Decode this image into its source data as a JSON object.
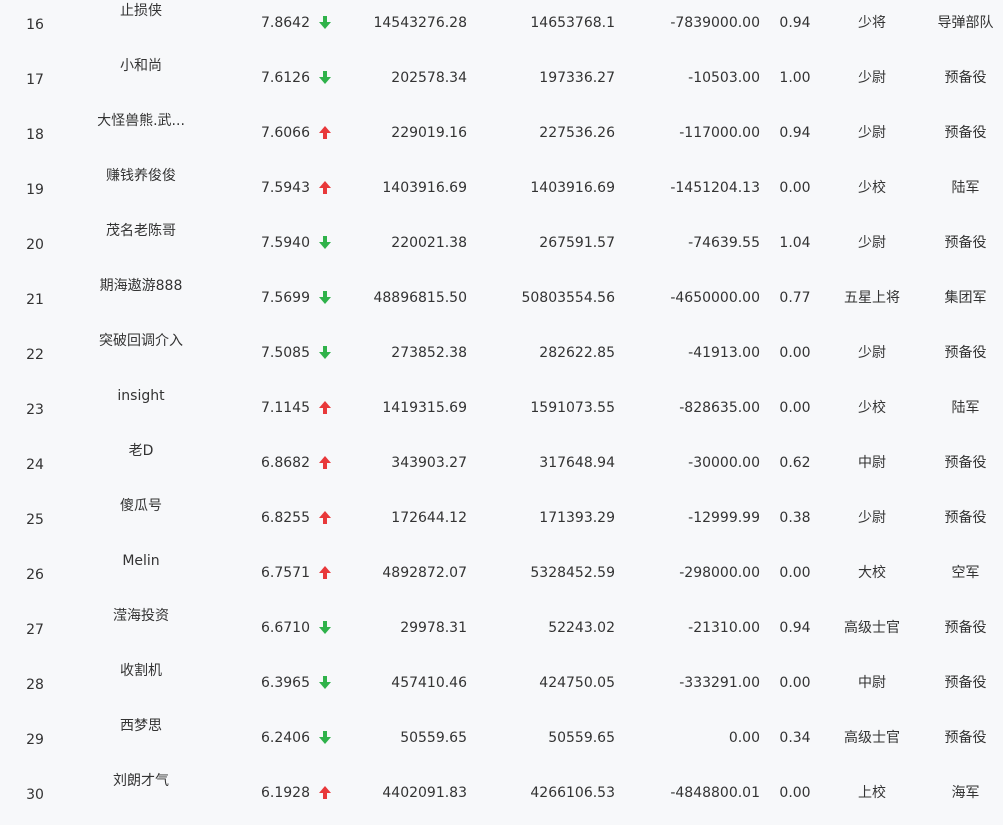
{
  "colors": {
    "background": "#f7f8fa",
    "text": "#333333",
    "arrow_up": "#e8383a",
    "arrow_down": "#2fb24a"
  },
  "rows": [
    {
      "rank": "16",
      "name": "止损侠",
      "score": "7.8642",
      "trend": "down",
      "v1": "14543276.28",
      "v2": "14653768.1",
      "v3": "-7839000.00",
      "v4": "0.94",
      "military_rank": "少将",
      "unit": "导弹部队"
    },
    {
      "rank": "17",
      "name": "小和尚",
      "score": "7.6126",
      "trend": "down",
      "v1": "202578.34",
      "v2": "197336.27",
      "v3": "-10503.00",
      "v4": "1.00",
      "military_rank": "少尉",
      "unit": "预备役"
    },
    {
      "rank": "18",
      "name": "大怪兽熊.武...",
      "score": "7.6066",
      "trend": "up",
      "v1": "229019.16",
      "v2": "227536.26",
      "v3": "-117000.00",
      "v4": "0.94",
      "military_rank": "少尉",
      "unit": "预备役"
    },
    {
      "rank": "19",
      "name": "赚钱养俊俊",
      "score": "7.5943",
      "trend": "up",
      "v1": "1403916.69",
      "v2": "1403916.69",
      "v3": "-1451204.13",
      "v4": "0.00",
      "military_rank": "少校",
      "unit": "陆军"
    },
    {
      "rank": "20",
      "name": "茂名老陈哥",
      "score": "7.5940",
      "trend": "down",
      "v1": "220021.38",
      "v2": "267591.57",
      "v3": "-74639.55",
      "v4": "1.04",
      "military_rank": "少尉",
      "unit": "预备役"
    },
    {
      "rank": "21",
      "name": "期海遨游888",
      "score": "7.5699",
      "trend": "down",
      "v1": "48896815.50",
      "v2": "50803554.56",
      "v3": "-4650000.00",
      "v4": "0.77",
      "military_rank": "五星上将",
      "unit": "集团军"
    },
    {
      "rank": "22",
      "name": "突破回调介入",
      "score": "7.5085",
      "trend": "down",
      "v1": "273852.38",
      "v2": "282622.85",
      "v3": "-41913.00",
      "v4": "0.00",
      "military_rank": "少尉",
      "unit": "预备役"
    },
    {
      "rank": "23",
      "name": "insight",
      "score": "7.1145",
      "trend": "up",
      "v1": "1419315.69",
      "v2": "1591073.55",
      "v3": "-828635.00",
      "v4": "0.00",
      "military_rank": "少校",
      "unit": "陆军"
    },
    {
      "rank": "24",
      "name": "老D",
      "score": "6.8682",
      "trend": "up",
      "v1": "343903.27",
      "v2": "317648.94",
      "v3": "-30000.00",
      "v4": "0.62",
      "military_rank": "中尉",
      "unit": "预备役"
    },
    {
      "rank": "25",
      "name": "傻瓜号",
      "score": "6.8255",
      "trend": "up",
      "v1": "172644.12",
      "v2": "171393.29",
      "v3": "-12999.99",
      "v4": "0.38",
      "military_rank": "少尉",
      "unit": "预备役"
    },
    {
      "rank": "26",
      "name": "Melin",
      "score": "6.7571",
      "trend": "up",
      "v1": "4892872.07",
      "v2": "5328452.59",
      "v3": "-298000.00",
      "v4": "0.00",
      "military_rank": "大校",
      "unit": "空军"
    },
    {
      "rank": "27",
      "name": "滢海投资",
      "score": "6.6710",
      "trend": "down",
      "v1": "29978.31",
      "v2": "52243.02",
      "v3": "-21310.00",
      "v4": "0.94",
      "military_rank": "高级士官",
      "unit": "预备役"
    },
    {
      "rank": "28",
      "name": "收割机",
      "score": "6.3965",
      "trend": "down",
      "v1": "457410.46",
      "v2": "424750.05",
      "v3": "-333291.00",
      "v4": "0.00",
      "military_rank": "中尉",
      "unit": "预备役"
    },
    {
      "rank": "29",
      "name": "西梦思",
      "score": "6.2406",
      "trend": "down",
      "v1": "50559.65",
      "v2": "50559.65",
      "v3": "0.00",
      "v4": "0.34",
      "military_rank": "高级士官",
      "unit": "预备役"
    },
    {
      "rank": "30",
      "name": "刘朗才气",
      "score": "6.1928",
      "trend": "up",
      "v1": "4402091.83",
      "v2": "4266106.53",
      "v3": "-4848800.01",
      "v4": "0.00",
      "military_rank": "上校",
      "unit": "海军"
    }
  ]
}
